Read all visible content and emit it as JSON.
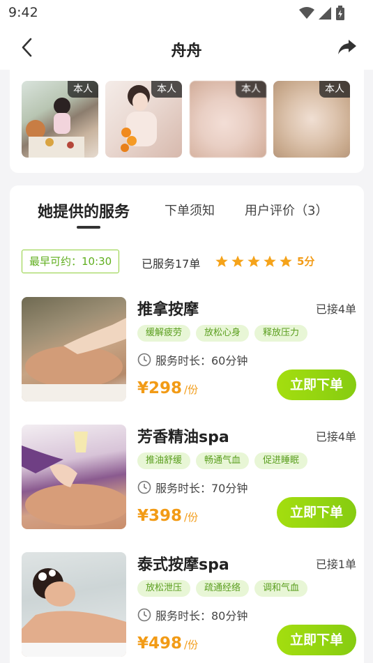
{
  "status": {
    "time": "9:42"
  },
  "nav": {
    "title": "舟舟"
  },
  "photos": [
    {
      "badge": "本人"
    },
    {
      "badge": "本人"
    },
    {
      "badge": "本人"
    },
    {
      "badge": "本人"
    }
  ],
  "tabs": [
    {
      "label": "她提供的服务"
    },
    {
      "label": "下单须知"
    },
    {
      "label": "用户评价（3）"
    }
  ],
  "summary": {
    "earliest": "最早可约：10:30",
    "served": "已服务17单",
    "rating_stars": 5,
    "score": "5分"
  },
  "services": [
    {
      "name": "推拿按摩",
      "taken": "已接4单",
      "tags": [
        "缓解疲劳",
        "放松心身",
        "释放压力"
      ],
      "duration": "服务时长：60分钟",
      "price": "¥298",
      "unit": "/份",
      "button": "立即下单"
    },
    {
      "name": "芳香精油spa",
      "taken": "已接4单",
      "tags": [
        "推油舒缓",
        "畅通气血",
        "促进睡眠"
      ],
      "duration": "服务时长：70分钟",
      "price": "¥398",
      "unit": "/份",
      "button": "立即下单"
    },
    {
      "name": "泰式按摩spa",
      "taken": "已接1单",
      "tags": [
        "放松泄压",
        "疏通经络",
        "调和气血"
      ],
      "duration": "服务时长：80分钟",
      "price": "¥498",
      "unit": "/份",
      "button": "立即下单"
    }
  ],
  "colors": {
    "accent_green": "#8fd114",
    "price_orange": "#f29b16",
    "star": "#f5a31a"
  }
}
